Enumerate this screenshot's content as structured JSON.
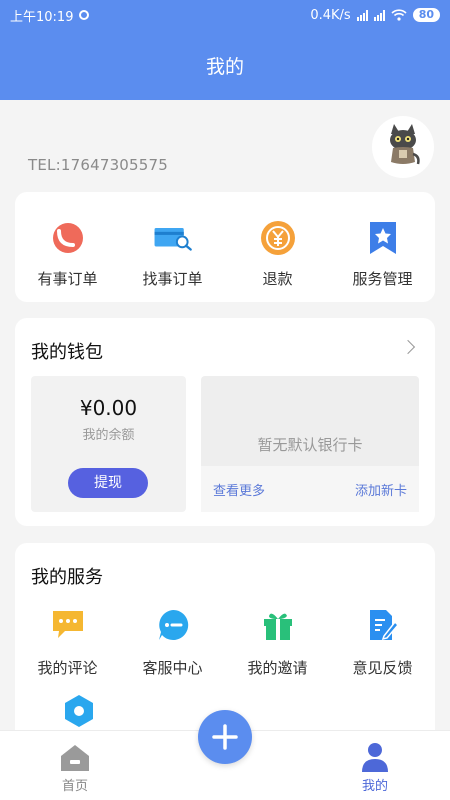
{
  "status_bar": {
    "time": "上午10:19",
    "network_speed": "0.4K/s",
    "battery": "80"
  },
  "header": {
    "title": "我的"
  },
  "profile": {
    "tel": "TEL:17647305575"
  },
  "quick_actions": [
    {
      "label": "有事订单",
      "icon": "order-circle-icon"
    },
    {
      "label": "找事订单",
      "icon": "search-card-icon"
    },
    {
      "label": "退款",
      "icon": "refund-yen-icon"
    },
    {
      "label": "服务管理",
      "icon": "bookmark-star-icon"
    }
  ],
  "wallet": {
    "title": "我的钱包",
    "balance": "¥0.00",
    "balance_label": "我的余额",
    "withdraw_label": "提现",
    "bank_empty": "暂无默认银行卡",
    "view_more": "查看更多",
    "add_card": "添加新卡"
  },
  "services": {
    "title": "我的服务",
    "items": [
      {
        "label": "我的评论",
        "icon": "comment-icon"
      },
      {
        "label": "客服中心",
        "icon": "chat-bubble-icon"
      },
      {
        "label": "我的邀请",
        "icon": "gift-icon"
      },
      {
        "label": "意见反馈",
        "icon": "feedback-edit-icon"
      }
    ]
  },
  "tabbar": {
    "home_label": "首页",
    "mine_label": "我的"
  },
  "colors": {
    "primary": "#5b8def",
    "button": "#5661e0",
    "link": "#5b79d8"
  }
}
